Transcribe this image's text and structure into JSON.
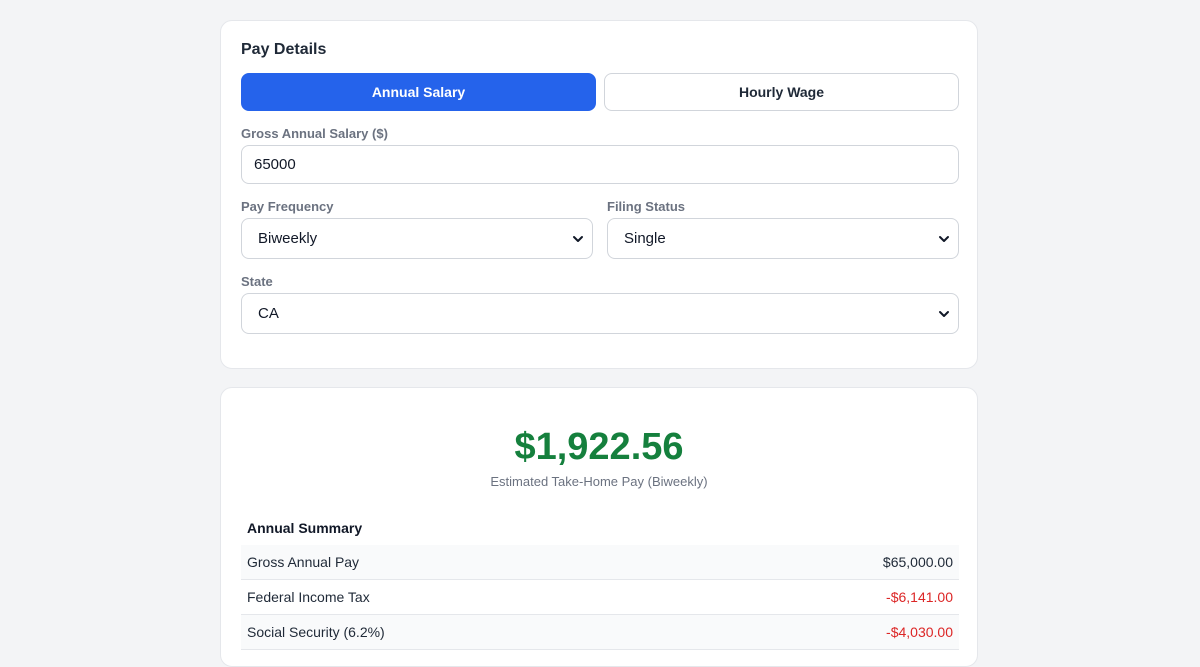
{
  "details": {
    "title": "Pay Details",
    "mode_tabs": {
      "annual": "Annual Salary",
      "hourly": "Hourly Wage",
      "active": "annual"
    },
    "salary": {
      "label": "Gross Annual Salary ($)",
      "value": "65000"
    },
    "pay_frequency": {
      "label": "Pay Frequency",
      "selected": "Biweekly"
    },
    "filing_status": {
      "label": "Filing Status",
      "selected": "Single"
    },
    "state": {
      "label": "State",
      "selected": "CA"
    }
  },
  "results": {
    "takehome_amount": "$1,922.56",
    "takehome_label": "Estimated Take-Home Pay (Biweekly)",
    "summary_title": "Annual Summary",
    "rows": [
      {
        "label": "Gross Annual Pay",
        "value": "$65,000.00",
        "negative": false
      },
      {
        "label": "Federal Income Tax",
        "value": "-$6,141.00",
        "negative": true
      },
      {
        "label": "Social Security (6.2%)",
        "value": "-$4,030.00",
        "negative": true
      }
    ]
  },
  "colors": {
    "accent": "#2563eb",
    "positive": "#15803d",
    "negative": "#dc2626",
    "background": "#f3f4f6"
  }
}
